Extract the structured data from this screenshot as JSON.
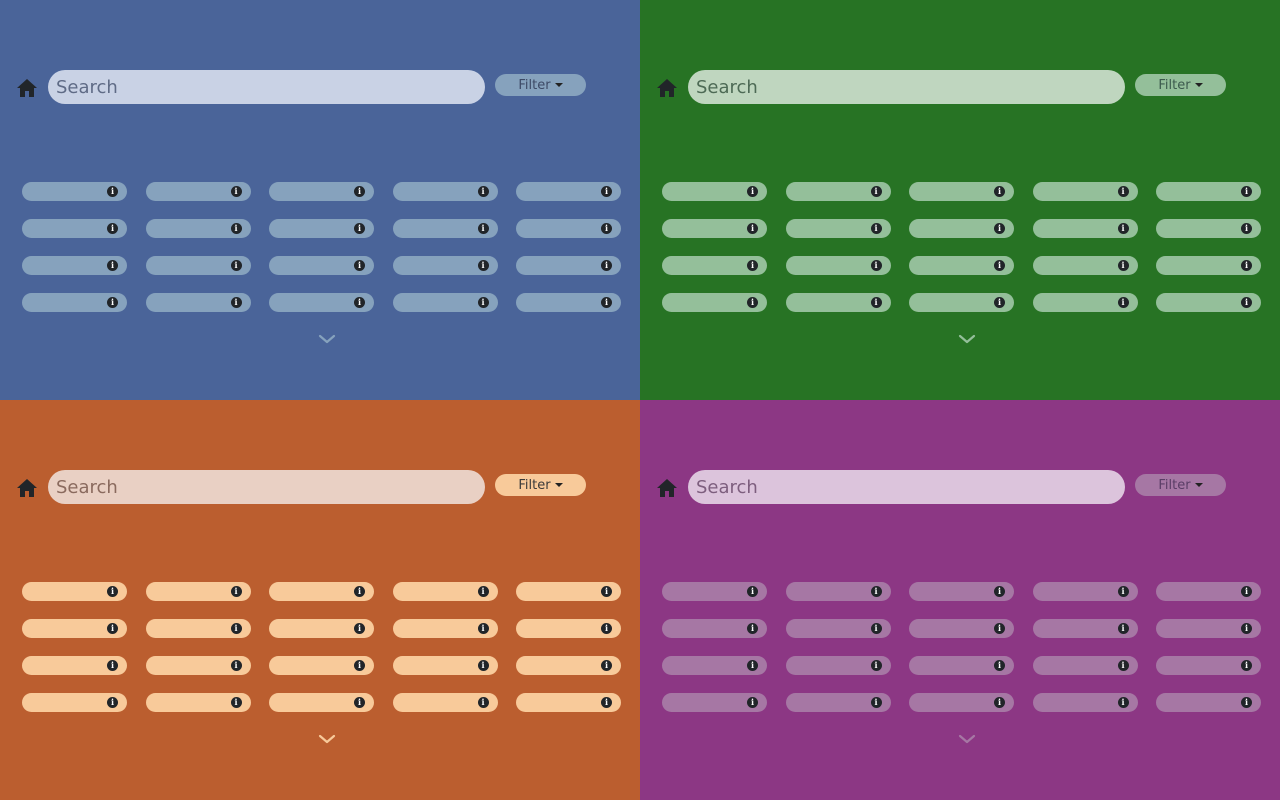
{
  "panels": [
    {
      "theme": {
        "background": "#4a6499",
        "search_bg": "#c9d2e5",
        "search_text": "#5f6b86",
        "filter_bg": "#86a2bd",
        "filter_text": "#3d4a66",
        "item_bg": "#86a2bd",
        "chevron": "#86a2bd"
      },
      "home_icon": "home-icon",
      "search": {
        "placeholder": "Search",
        "value": ""
      },
      "filter": {
        "label": "Filter"
      },
      "items": [
        {},
        {},
        {},
        {},
        {},
        {},
        {},
        {},
        {},
        {},
        {},
        {},
        {},
        {},
        {},
        {},
        {},
        {},
        {},
        {}
      ],
      "item_icon": "info-icon",
      "more_icon": "chevron-down-icon"
    },
    {
      "theme": {
        "background": "#277324",
        "search_bg": "#bfd6bf",
        "search_text": "#4d6a55",
        "filter_bg": "#94bf9a",
        "filter_text": "#3c5a4d",
        "item_bg": "#94bf9a",
        "chevron": "#94bf9a"
      },
      "home_icon": "home-icon",
      "search": {
        "placeholder": "Search",
        "value": ""
      },
      "filter": {
        "label": "Filter"
      },
      "items": [
        {},
        {},
        {},
        {},
        {},
        {},
        {},
        {},
        {},
        {},
        {},
        {},
        {},
        {},
        {},
        {},
        {},
        {},
        {},
        {}
      ],
      "item_icon": "info-icon",
      "more_icon": "chevron-down-icon"
    },
    {
      "theme": {
        "background": "#bb5e2f",
        "search_bg": "#e9d0c4",
        "search_text": "#8a6a5e",
        "filter_bg": "#f8ca9a",
        "filter_text": "#3a3a3a",
        "item_bg": "#f8ca9a",
        "chevron": "#f8ca9a"
      },
      "home_icon": "home-icon",
      "search": {
        "placeholder": "Search",
        "value": ""
      },
      "filter": {
        "label": "Filter"
      },
      "items": [
        {},
        {},
        {},
        {},
        {},
        {},
        {},
        {},
        {},
        {},
        {},
        {},
        {},
        {},
        {},
        {},
        {},
        {},
        {},
        {}
      ],
      "item_icon": "info-icon",
      "more_icon": "chevron-down-icon"
    },
    {
      "theme": {
        "background": "#8c3784",
        "search_bg": "#dcc4dc",
        "search_text": "#7d5e7e",
        "filter_bg": "#a677a4",
        "filter_text": "#5a3d66",
        "item_bg": "#a677a4",
        "chevron": "#a677a4"
      },
      "home_icon": "home-icon",
      "search": {
        "placeholder": "Search",
        "value": ""
      },
      "filter": {
        "label": "Filter"
      },
      "items": [
        {},
        {},
        {},
        {},
        {},
        {},
        {},
        {},
        {},
        {},
        {},
        {},
        {},
        {},
        {},
        {},
        {},
        {},
        {},
        {}
      ],
      "item_icon": "info-icon",
      "more_icon": "chevron-down-icon"
    }
  ]
}
